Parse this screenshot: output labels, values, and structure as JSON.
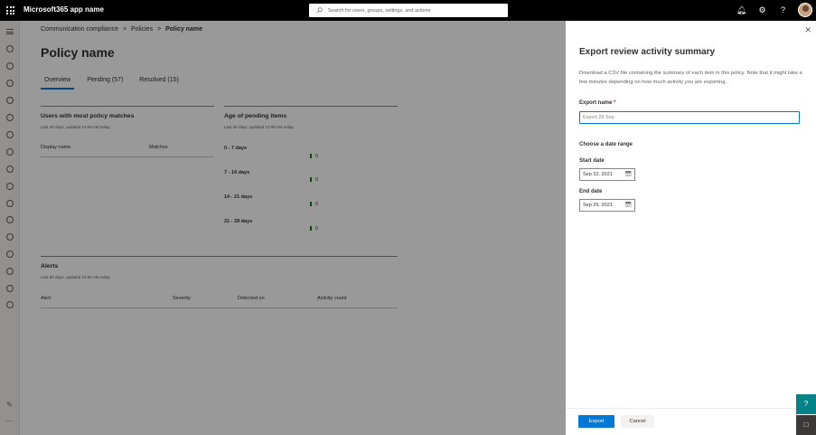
{
  "topbar": {
    "app_name": "Microsoft365 app name",
    "search_placeholder": "Search for users, groups, settings, and actions"
  },
  "breadcrumb": {
    "items": [
      "Communication compliance",
      "Policies",
      "Policy name"
    ],
    "separator": ">"
  },
  "page": {
    "title": "Policy name",
    "tabs": [
      {
        "label": "Overview",
        "active": true
      },
      {
        "label": "Pending (57)",
        "active": false
      },
      {
        "label": "Resolved (15)",
        "active": false
      }
    ]
  },
  "users_card": {
    "title": "Users with most policy matches",
    "subtitle": "Last 30 days, updated 10:08 AM today",
    "columns": [
      "Display name",
      "Matches"
    ]
  },
  "age_card": {
    "title": "Age of pending items",
    "subtitle": "Last 30 days, updated 10:08 AM today",
    "rows": [
      {
        "label": "0 - 7 days",
        "value": "0"
      },
      {
        "label": "7 - 14 days",
        "value": "0"
      },
      {
        "label": "14 - 21 days",
        "value": "0"
      },
      {
        "label": "21 - 28 days",
        "value": "0"
      }
    ]
  },
  "alerts_card": {
    "title": "Alerts",
    "subtitle": "Last 30 days, updated 10:08 AM today",
    "columns": [
      "Alert",
      "Severity",
      "Detected on",
      "Activity count"
    ]
  },
  "panel": {
    "title": "Export review activity summary",
    "description": "Download a CSV file containing the summary of each item in this policy. Note that it might take a few minutes depending on how much activity you are exporting.",
    "export_name_label": "Export name",
    "required_mark": "*",
    "export_name_value": "Export 29 Sep",
    "date_range_label": "Choose a date range",
    "start_date_label": "Start date",
    "start_date_value": "Sep 22, 2021",
    "end_date_label": "End date",
    "end_date_value": "Sep 29, 2021",
    "export_button": "Export",
    "cancel_button": "Cancel"
  },
  "colors": {
    "accent": "#0078d4",
    "topbar": "#000000",
    "bar": "#107c10",
    "help_button": "#038387"
  }
}
